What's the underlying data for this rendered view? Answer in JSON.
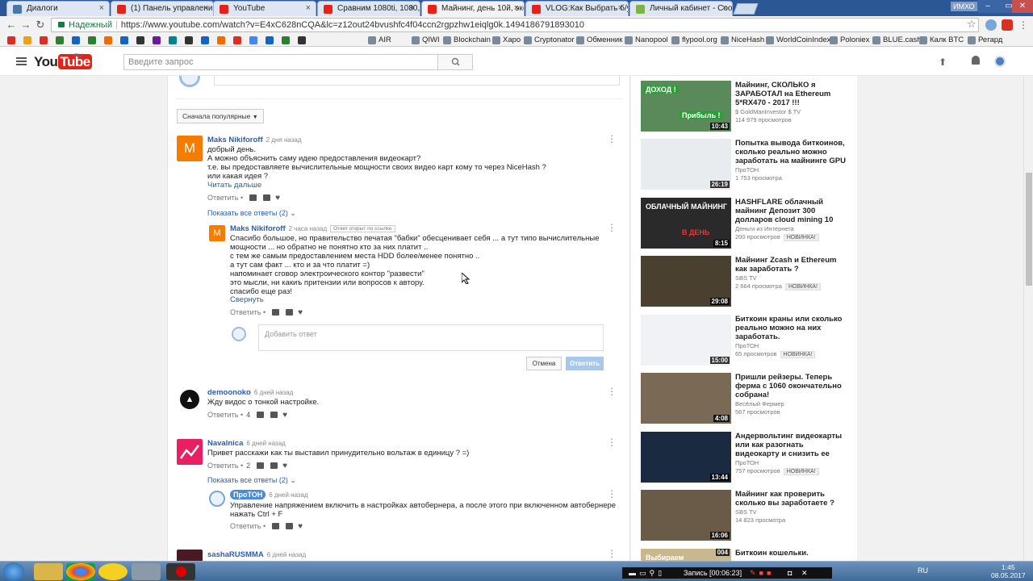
{
  "browser": {
    "tabs": [
      {
        "title": "Диалоги",
        "fav": "#4a76a8",
        "active": false
      },
      {
        "title": "(1) Панель управления в",
        "fav": "#e62117",
        "active": false
      },
      {
        "title": "YouTube",
        "fav": "#e62117",
        "active": false
      },
      {
        "title": "Сравним 1080ti, 1080, 1",
        "fav": "#e62117",
        "active": false
      },
      {
        "title": "Майнинг, день 10й, эксп",
        "fav": "#e62117",
        "active": true
      },
      {
        "title": "VLOG:Как Выбрать б/у к",
        "fav": "#e62117",
        "active": false
      },
      {
        "title": "Личный кабинет - Сооб",
        "fav": "#7cb342",
        "active": false
      }
    ],
    "user_label": "ИМХО",
    "secure_label": "Надежный",
    "url": "https://www.youtube.com/watch?v=E4xC628nCQA&lc=z12out24bvushfc4f04ccn2rgpzhw1eiqlg0k.1494186791893010",
    "bookmarks": [
      "AIR",
      "QIWI",
      "Blockchain",
      "Xapo",
      "Cryptonator",
      "Обменник",
      "Nanopool",
      "flypool.org",
      "NiceHash",
      "WorldCoinIndex",
      "Poloniex",
      "BLUE.cash",
      "Калк BTC",
      "Регард"
    ]
  },
  "masthead": {
    "logo_you": "You",
    "logo_tube": "Tube",
    "logo_region": "RU",
    "search_placeholder": "Введите запрос"
  },
  "comments": {
    "sort_label": "Сначала популярные",
    "reply_label": "Ответить",
    "read_more": "Читать дальше",
    "collapse": "Свернуть",
    "cancel_btn": "Отмена",
    "submit_btn": "Ответить",
    "reply_placeholder": "Добавить ответ",
    "linked_badge": "Ответ открыт по ссылке",
    "c1": {
      "author": "Maks Nikiforoff",
      "time": "2 дня назад",
      "text": "добрый день.\nА можно объяснить саму идею предоставления видеокарт?\nт.е. вы предоставляете вычислительные мощности своих видео карт кому то через NiceHash ?\nили какая идея ?",
      "show_replies": "Показать все ответы (2)"
    },
    "r1": {
      "author": "Maks Nikiforoff",
      "time": "2 часа назад",
      "text": "Спасибо большое, но правительство печатая \"бабки\" обесценивает себя ... а тут  типо вычислительные\nмощности ... но обратно не понятно кто за них платит ..\nс тем же самым предоставлением места HDD более/менее понятно ..\nа тут сам факт ... кто и за что платит =)\nнапоминает сговор электроического контор \"развести\"\nэто мысли, ни какиъ притензии или вопросов к автору.\nспасибо еще раз!"
    },
    "c2": {
      "author": "demoonoko",
      "time": "6 дней назад",
      "text": "Жду видос о тонкой настройке.",
      "likes": "4"
    },
    "c3": {
      "author": "Navalnica",
      "time": "6 дней назад",
      "text": "Привет расскажи как ты выставил принудительно вольтаж в единицу ?  =)",
      "likes": "2",
      "show_replies": "Показать все ответы (2)"
    },
    "r3": {
      "author": "ПроТОН",
      "time": "6 дней назад",
      "text": "Управление напряжением включить в настройках автобернера, а после этого при включенном автобернере\nнажать Ctrl + F"
    },
    "c4": {
      "author": "sashaRUSMMA",
      "time": "6 дней назад"
    }
  },
  "sidebar": {
    "new_badge": "НОВИНКА!",
    "videos": [
      {
        "title": "Майнинг, СКОЛЬКО я ЗАРАБОТАЛ на Ethereum 5*RX470 - 2017 !!!",
        "channel": "$ GoldManInvestor $ TV",
        "views": "114 979 просмотров",
        "duration": "10:43",
        "new": false,
        "thumb": "#5a8a5a",
        "overlay1": "ДОХОД !",
        "overlay2": "Прибыль !"
      },
      {
        "title": "Попытка вывода биткоинов, сколько реально можно заработать на майнинге GPU",
        "channel": "ПроТОН",
        "views": "1 753 просмотра",
        "duration": "26:19",
        "new": false,
        "thumb": "#e8ecef",
        "overlay1": "",
        "overlay2": ""
      },
      {
        "title": "HASHFLARE облачный майнинг Депозит 300 долларов cloud mining 10",
        "channel": "Деньги из Интернета",
        "views": "200 просмотров",
        "duration": "8:15",
        "new": true,
        "thumb": "#2a2a2a",
        "overlay1": "ОБЛАЧНЫЙ МАЙНИНГ",
        "overlay2": "В ДЕНЬ"
      },
      {
        "title": "Майнинг Zcash и Ethereum как заработать ?",
        "channel": "SBS TV",
        "views": "2 664 просмотра",
        "duration": "29:08",
        "new": true,
        "thumb": "#4a4030",
        "overlay1": "",
        "overlay2": ""
      },
      {
        "title": "Биткоин краны или сколько реально можно на них заработать.",
        "channel": "ПроТОН",
        "views": "65 просмотров",
        "duration": "15:00",
        "new": true,
        "thumb": "#f0f2f5",
        "overlay1": "",
        "overlay2": ""
      },
      {
        "title": "Пришли рейзеры. Теперь ферма с 1060 окончательно собрана!",
        "channel": "Весёлый Фермер",
        "views": "567 просмотров",
        "duration": "4:08",
        "new": false,
        "thumb": "#7a6a55",
        "overlay1": "",
        "overlay2": ""
      },
      {
        "title": "Андервольтинг видеокарты или как разогнать видеокарту и снизить ее",
        "channel": "ПроТОН",
        "views": "757 просмотров",
        "duration": "13:44",
        "new": true,
        "thumb": "#1a2a40",
        "overlay1": "",
        "overlay2": ""
      },
      {
        "title": "Майнинг как проверить сколько вы заработаете ?",
        "channel": "SBS TV",
        "views": "14 823 просмотра",
        "duration": "16:06",
        "new": false,
        "thumb": "#6a5a48",
        "overlay1": "",
        "overlay2": ""
      },
      {
        "title": "Биткоин кошельки.",
        "channel": "",
        "views": "",
        "duration": "004",
        "new": false,
        "thumb": "#c8b890",
        "overlay1": "Выбираем",
        "overlay2": ""
      }
    ]
  },
  "taskbar": {
    "recording": "Запись [00:06:23]",
    "lang": "RU",
    "time": "1:45",
    "date": "08.05.2017"
  }
}
